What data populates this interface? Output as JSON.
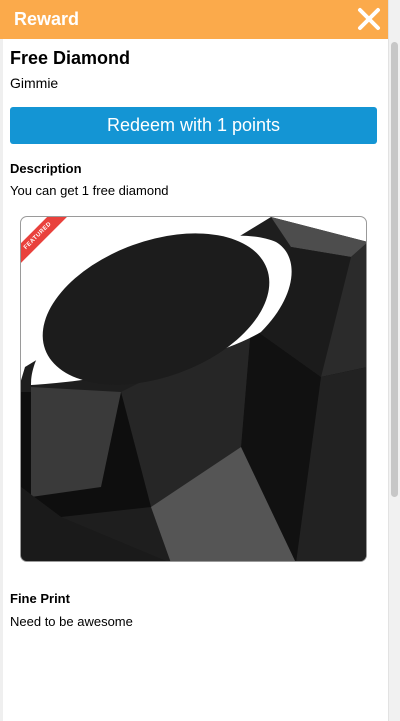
{
  "header": {
    "title": "Reward",
    "close_icon": "close-icon"
  },
  "reward": {
    "title": "Free Diamond",
    "subtitle": "Gimmie",
    "redeem_label": "Redeem with 1 points",
    "description_heading": "Description",
    "description_text": "You can get 1 free diamond",
    "ribbon_label": "FEATURED",
    "image_icon": "ruby-gem-image",
    "fine_print_heading": "Fine Print",
    "fine_print_text": "Need to be awesome"
  },
  "colors": {
    "header": "#fbaa4b",
    "button": "#1495d4",
    "ribbon": "#e9413c"
  }
}
